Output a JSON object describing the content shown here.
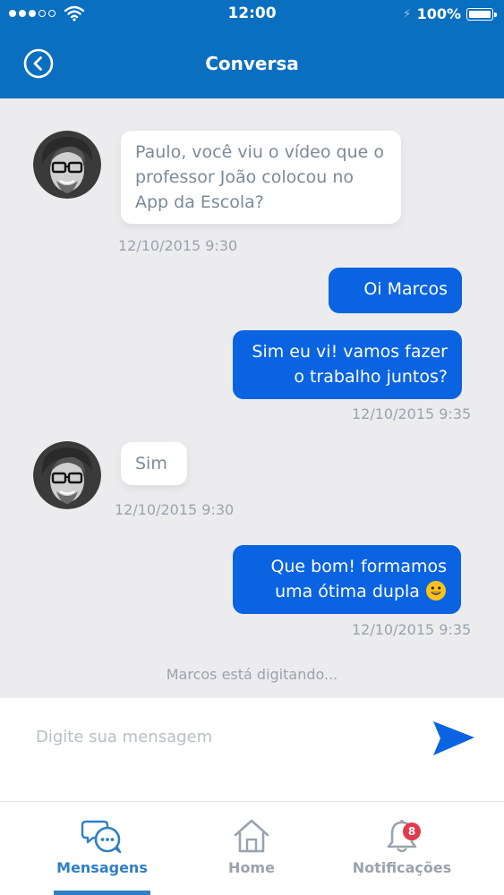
{
  "status_bar": {
    "time": "12:00",
    "battery": "100%"
  },
  "header": {
    "title": "Conversa",
    "back_icon": "chevron-left-circle-icon"
  },
  "messages": [
    {
      "direction": "in",
      "text": "Paulo, você viu o vídeo que o professor João colocou no App da Escola?",
      "timestamp": "12/10/2015 9:30"
    },
    {
      "direction": "out",
      "text": "Oi Marcos"
    },
    {
      "direction": "out",
      "text": "Sim eu vi! vamos fazer o trabalho juntos?",
      "timestamp": "12/10/2015 9:35"
    },
    {
      "direction": "in",
      "text": "Sim",
      "timestamp": "12/10/2015 9:30"
    },
    {
      "direction": "out",
      "text": "Que bom! formamos uma ótima dupla",
      "emoji": "😀",
      "timestamp": "12/10/2015 9:35"
    }
  ],
  "typing_indicator": "Marcos está digitando...",
  "composer": {
    "placeholder": "Digite sua mensagem",
    "value": "",
    "send_icon": "send-icon"
  },
  "tabbar": {
    "tabs": [
      {
        "label": "Mensagens",
        "icon": "chat-bubbles-icon",
        "active": true
      },
      {
        "label": "Home",
        "icon": "home-icon",
        "active": false
      },
      {
        "label": "Notificações",
        "icon": "bell-icon",
        "active": false,
        "badge": "8"
      }
    ]
  },
  "colors": {
    "primary": "#0b6fbf",
    "bubble_out": "#0a63e0",
    "accent": "#2f7fc4",
    "badge": "#e23a4b"
  }
}
